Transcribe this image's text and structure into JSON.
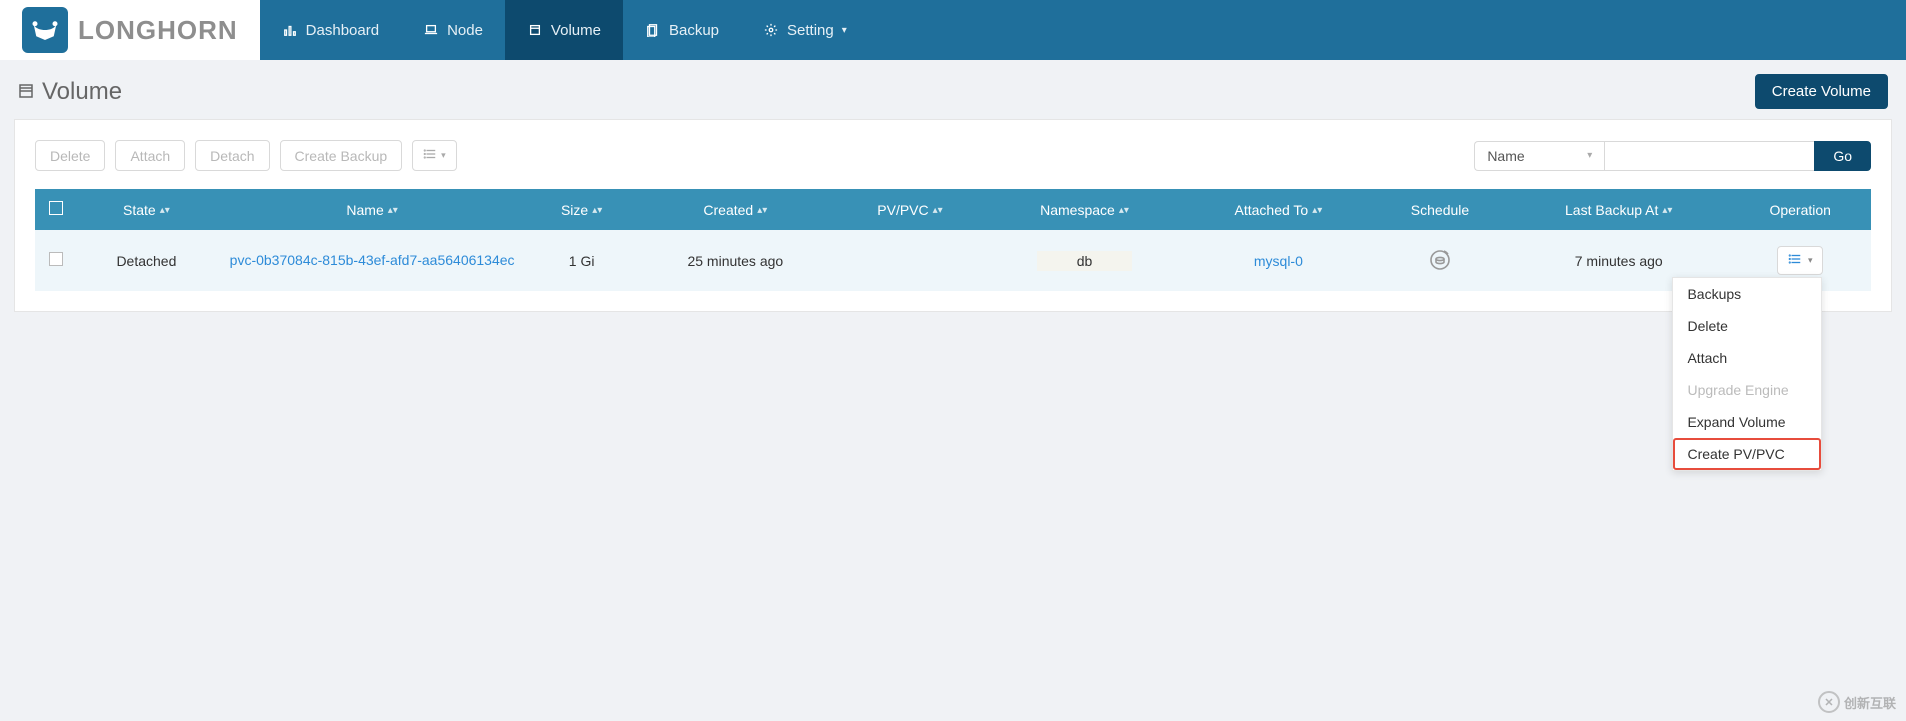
{
  "brand": "LONGHORN",
  "nav": {
    "dashboard": "Dashboard",
    "node": "Node",
    "volume": "Volume",
    "backup": "Backup",
    "setting": "Setting"
  },
  "page": {
    "title": "Volume",
    "create_button": "Create Volume"
  },
  "toolbar": {
    "delete": "Delete",
    "attach": "Attach",
    "detach": "Detach",
    "create_backup": "Create Backup",
    "filter_field": "Name",
    "go": "Go"
  },
  "columns": {
    "state": "State",
    "name": "Name",
    "size": "Size",
    "created": "Created",
    "pv_pvc": "PV/PVC",
    "namespace": "Namespace",
    "attached_to": "Attached To",
    "schedule": "Schedule",
    "last_backup_at": "Last Backup At",
    "operation": "Operation"
  },
  "rows": [
    {
      "state": "Detached",
      "name": "pvc-0b37084c-815b-43ef-afd7-aa56406134ec",
      "size": "1 Gi",
      "created": "25 minutes ago",
      "pv_pvc": "",
      "namespace": "db",
      "attached_to": "mysql-0",
      "last_backup_at": "7 minutes ago"
    }
  ],
  "op_menu": {
    "backups": "Backups",
    "delete": "Delete",
    "attach": "Attach",
    "upgrade_engine": "Upgrade Engine",
    "expand_volume": "Expand Volume",
    "create_pv_pvc": "Create PV/PVC"
  },
  "watermark": "创新互联"
}
